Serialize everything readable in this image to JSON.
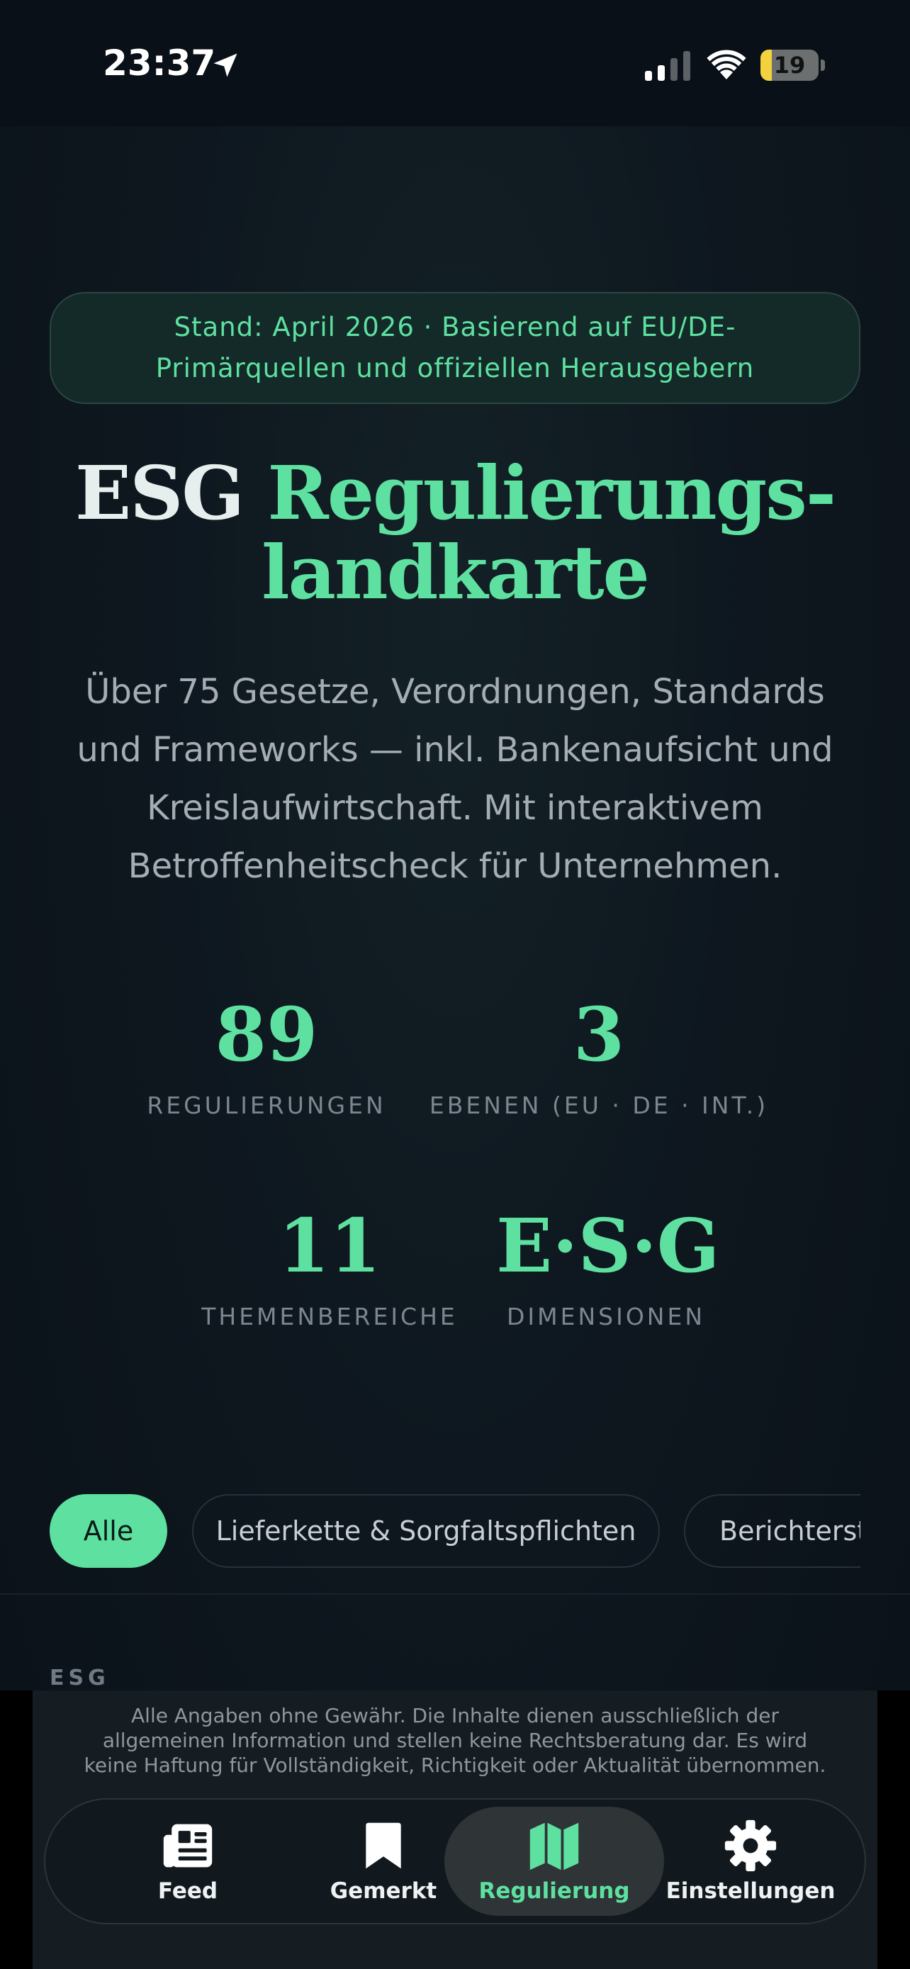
{
  "status_bar": {
    "time": "23:37",
    "battery_level": "19",
    "battery_fraction": 0.19,
    "icons": [
      "location-arrow-icon",
      "cellular-signal-icon",
      "wifi-icon",
      "battery-icon"
    ]
  },
  "notice": {
    "text": "Stand: April 2026 · Basierend auf EU/DE-Primärquellen und offiziellen Herausgebern"
  },
  "hero": {
    "title_part1": "ESG",
    "title_part2": "Regulierungs-",
    "title_part3": "landkarte",
    "subtitle": "Über 75 Gesetze, Verordnungen, Standards und Frameworks — inkl. Bankenaufsicht und Kreislaufwirtschaft. Mit interaktivem Betroffenheitscheck für Unternehmen."
  },
  "stats": [
    {
      "value": "89",
      "label": "REGULIERUNGEN"
    },
    {
      "value": "3",
      "label": "EBENEN (EU · DE · INT.)"
    },
    {
      "value": "11",
      "label": "THEMENBEREICHE"
    },
    {
      "value": "E·S·G",
      "label": "DIMENSIONEN"
    }
  ],
  "filters": [
    {
      "label": "Alle",
      "active": true
    },
    {
      "label": "Lieferkette & Sorgfaltspflichten",
      "active": false
    },
    {
      "label": "Berichterst",
      "active": false
    }
  ],
  "section": {
    "label": "ESG"
  },
  "disclaimer": "Alle Angaben ohne Gewähr. Die Inhalte dienen ausschließlich der allgemeinen Information und stellen keine Rechtsberatung dar. Es wird keine Haftung für Vollständigkeit, Richtigkeit oder Aktualität übernommen.",
  "tabs": [
    {
      "label": "Feed",
      "icon": "newspaper-icon",
      "active": false
    },
    {
      "label": "Gemerkt",
      "icon": "bookmark-icon",
      "active": false
    },
    {
      "label": "Regulierung",
      "icon": "map-icon",
      "active": true
    },
    {
      "label": "Einstellungen",
      "icon": "gear-icon",
      "active": false
    }
  ],
  "colors": {
    "accent": "#5ee0a0",
    "background": "#0e171f",
    "muted_text": "#a5adb3"
  }
}
